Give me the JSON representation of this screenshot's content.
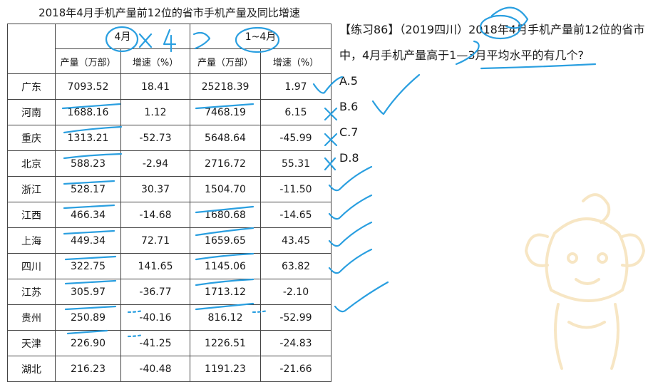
{
  "table": {
    "title": "2018年4月手机产量前12位的省市手机产量及同比增速",
    "group_headers": [
      "4月",
      "1~4月"
    ],
    "sub_headers": [
      "产量（万部）",
      "增速（%）",
      "产量（万部）",
      "增速（%）"
    ],
    "rows": [
      {
        "province": "广东",
        "apr_output": "7093.52",
        "apr_growth": "18.41",
        "ytd_output": "25218.39",
        "ytd_growth": "1.97"
      },
      {
        "province": "河南",
        "apr_output": "1688.16",
        "apr_growth": "1.12",
        "ytd_output": "7468.19",
        "ytd_growth": "6.15"
      },
      {
        "province": "重庆",
        "apr_output": "1313.21",
        "apr_growth": "-52.73",
        "ytd_output": "5648.64",
        "ytd_growth": "-45.99"
      },
      {
        "province": "北京",
        "apr_output": "588.23",
        "apr_growth": "-2.94",
        "ytd_output": "2716.72",
        "ytd_growth": "55.31"
      },
      {
        "province": "浙江",
        "apr_output": "528.17",
        "apr_growth": "30.37",
        "ytd_output": "1504.70",
        "ytd_growth": "-11.50"
      },
      {
        "province": "江西",
        "apr_output": "466.34",
        "apr_growth": "-14.68",
        "ytd_output": "1680.68",
        "ytd_growth": "-14.65"
      },
      {
        "province": "上海",
        "apr_output": "449.34",
        "apr_growth": "72.71",
        "ytd_output": "1659.65",
        "ytd_growth": "43.45"
      },
      {
        "province": "四川",
        "apr_output": "322.75",
        "apr_growth": "141.65",
        "ytd_output": "1145.06",
        "ytd_growth": "63.82"
      },
      {
        "province": "江苏",
        "apr_output": "305.97",
        "apr_growth": "-36.77",
        "ytd_output": "1713.12",
        "ytd_growth": "-2.10"
      },
      {
        "province": "贵州",
        "apr_output": "250.89",
        "apr_growth": "-40.16",
        "ytd_output": "816.12",
        "ytd_growth": "-52.99"
      },
      {
        "province": "天津",
        "apr_output": "226.90",
        "apr_growth": "-41.25",
        "ytd_output": "1226.51",
        "ytd_growth": "-24.83"
      },
      {
        "province": "湖北",
        "apr_output": "216.23",
        "apr_growth": "-40.48",
        "ytd_output": "1191.23",
        "ytd_growth": "-21.66"
      }
    ]
  },
  "question": {
    "stem": "【练习86】（2019四川）2018年4月手机产量前12位的省市中，4月手机产量高于1—3月平均水平的有几个?",
    "options": [
      "A.5",
      "B.6",
      "C.7",
      "D.8"
    ]
  },
  "annotations": {
    "multiplier_note": "×4",
    "compare_note": ">",
    "ink_color": "#2a9fe0"
  }
}
